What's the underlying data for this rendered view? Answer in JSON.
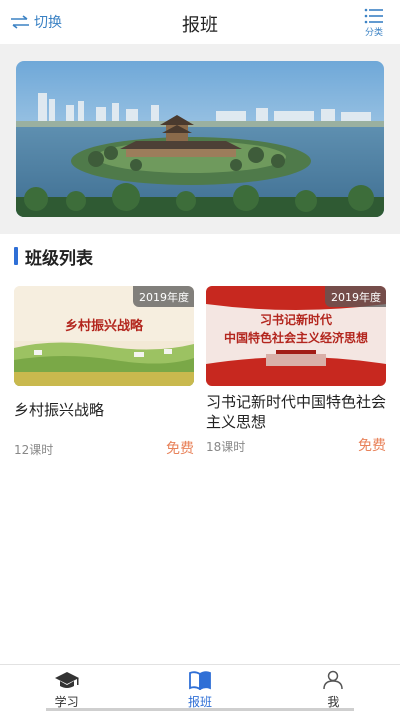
{
  "header": {
    "switch_label": "切换",
    "title": "报班",
    "category_label": "分类"
  },
  "banner": {
    "image": "lakeside-pavilion-cityscape"
  },
  "section": {
    "title": "班级列表"
  },
  "cards": [
    {
      "image_caption": "乡村振兴战略",
      "year": "2019年度",
      "title": "乡村振兴战略",
      "lessons": "12课时",
      "price": "免费"
    },
    {
      "image_caption_line1": "习书记新时代",
      "image_caption_line2": "中国特色社会主义经济思想",
      "year": "2019年度",
      "title": "习书记新时代中国特色社会主义思想",
      "lessons": "18课时",
      "price": "免费"
    }
  ],
  "tabbar": {
    "items": [
      {
        "label": "学习",
        "icon": "graduation-cap-icon"
      },
      {
        "label": "报班",
        "icon": "book-icon",
        "active": true
      },
      {
        "label": "我",
        "icon": "user-icon"
      }
    ]
  },
  "colors": {
    "accent": "#2f6fd6",
    "link": "#3b82c4",
    "price": "#e8825a"
  }
}
